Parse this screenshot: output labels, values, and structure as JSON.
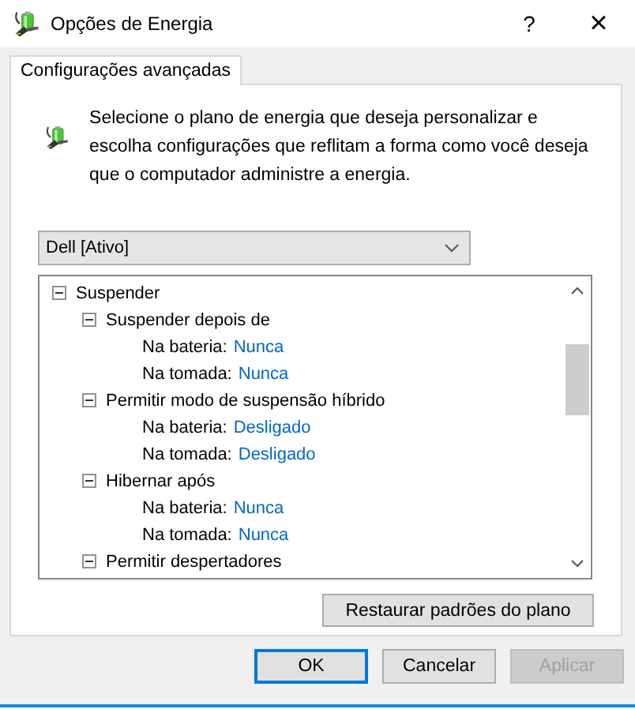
{
  "window": {
    "title": "Opções de Energia",
    "help": "?",
    "close": "×"
  },
  "tabs": [
    {
      "label": "Configurações avançadas",
      "selected": true
    }
  ],
  "description": "Selecione o plano de energia que deseja personalizar e escolha configurações que reflitam a forma como você deseja que o computador administre a energia.",
  "plan_dropdown": {
    "value": "Dell [Ativo]"
  },
  "settings_tree": [
    {
      "label": "Suspender",
      "expanded": true,
      "children": [
        {
          "label": "Suspender depois de",
          "expanded": true,
          "children": [
            {
              "label": "Na bateria:",
              "value": "Nunca"
            },
            {
              "label": "Na tomada:",
              "value": "Nunca"
            }
          ]
        },
        {
          "label": "Permitir modo de suspensão híbrido",
          "expanded": true,
          "children": [
            {
              "label": "Na bateria:",
              "value": "Desligado"
            },
            {
              "label": "Na tomada:",
              "value": "Desligado"
            }
          ]
        },
        {
          "label": "Hibernar após",
          "expanded": true,
          "children": [
            {
              "label": "Na bateria:",
              "value": "Nunca"
            },
            {
              "label": "Na tomada:",
              "value": "Nunca"
            }
          ]
        },
        {
          "label": "Permitir despertadores",
          "expanded": true
        }
      ]
    }
  ],
  "restore_button": "Restaurar padrões do plano",
  "buttons": [
    {
      "label": "OK",
      "default": true,
      "disabled": false
    },
    {
      "label": "Cancelar",
      "default": false,
      "disabled": false
    },
    {
      "label": "Aplicar",
      "default": false,
      "disabled": true
    }
  ]
}
